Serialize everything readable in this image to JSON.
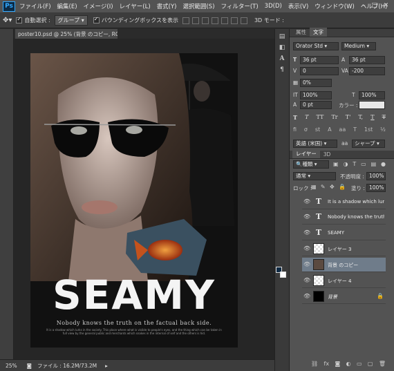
{
  "app": {
    "logo": "Ps"
  },
  "menu": [
    "ファイル(F)",
    "編集(E)",
    "イメージ(I)",
    "レイヤー(L)",
    "書式(Y)",
    "選択範囲(S)",
    "フィルター(T)",
    "3D(D)",
    "表示(V)",
    "ウィンドウ(W)",
    "ヘルプ(H)"
  ],
  "options": {
    "auto_select_label": "自動選択 :",
    "auto_select_value": "グループ",
    "bounding_box_label": "バウンディングボックスを表示",
    "mode3d_label": "3D モード :"
  },
  "document": {
    "tab_title": "poster10.psd @ 25% (背景 のコピー, RGB/8) *"
  },
  "poster": {
    "title": "SEAMY",
    "tagline": "Nobody knows the truth on the factual back side.",
    "body": "It is a shadow which lurks in the society. This place where what is visible to people's eyes, and the thing which can be taken in full view by the general public and merchants which snakes in the internal of self and the others is hid."
  },
  "status": {
    "zoom": "25%",
    "file_info": "ファイル : 16.2M/73.2M"
  },
  "character_panel": {
    "tabs": [
      "属性",
      "文字"
    ],
    "font_family": "Orator Std",
    "font_style": "Medium",
    "font_size": "36 pt",
    "leading": "36 pt",
    "kerning": "0",
    "tracking": "-200",
    "tsume": "0%",
    "vscale": "100%",
    "hscale": "100%",
    "baseline": "0 pt",
    "color_label": "カラー :",
    "language": "英語 (米国)",
    "antialias": "シャープ",
    "style_buttons": [
      "T",
      "T",
      "TT",
      "Tr",
      "T'",
      "T,",
      "T",
      "T"
    ]
  },
  "layers_panel": {
    "tabs": [
      "レイヤー",
      "3D"
    ],
    "filter_kind": "種類",
    "blend_mode": "通常",
    "opacity_label": "不透明度 :",
    "opacity_value": "100%",
    "lock_label": "ロック :",
    "fill_label": "塗り :",
    "fill_value": "100%",
    "layers": [
      {
        "name": "It is a shadow which lurks...",
        "type": "text",
        "selected": false
      },
      {
        "name": "Nobody knows the truth ...",
        "type": "text",
        "selected": false
      },
      {
        "name": "SEAMY",
        "type": "text",
        "selected": false
      },
      {
        "name": "レイヤー 3",
        "type": "pixel",
        "selected": false
      },
      {
        "name": "背景 のコピー",
        "type": "pixel",
        "selected": true
      },
      {
        "name": "レイヤー 4",
        "type": "pixel",
        "selected": false
      },
      {
        "name": "背景",
        "type": "background",
        "selected": false
      }
    ]
  }
}
